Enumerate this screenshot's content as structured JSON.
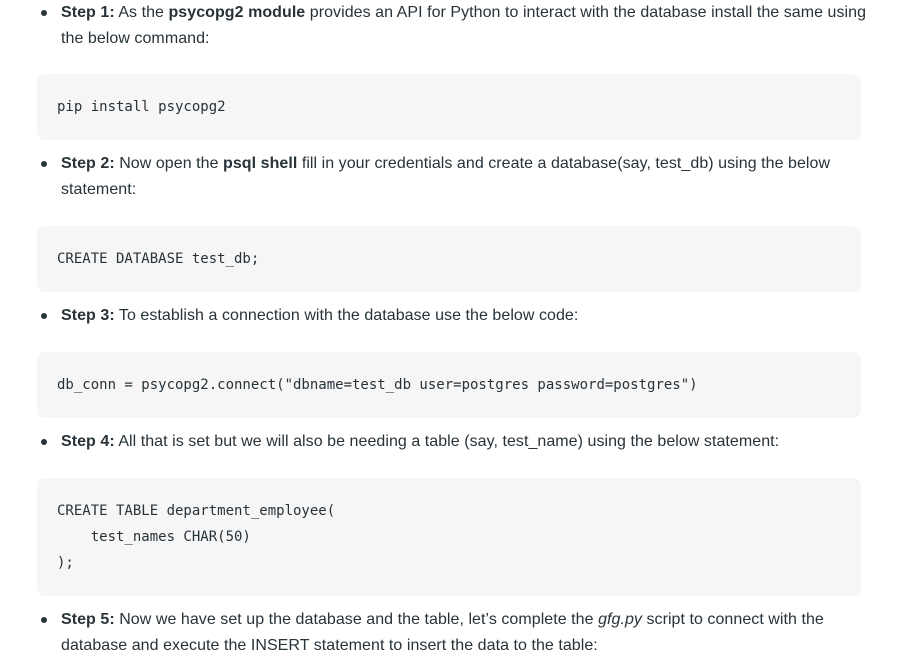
{
  "steps": [
    {
      "label": "Step 1:",
      "parts": [
        " As the ",
        "psycopg2 module",
        " provides an API for Python to interact with the database install the same using the below command:"
      ]
    },
    {
      "label": "Step 2:",
      "parts": [
        " Now open the ",
        "psql shell",
        " fill in your credentials and create a database(say, test_db) using the below statement:"
      ]
    },
    {
      "label": "Step 3:",
      "text": " To establish a connection with the database use the below code:"
    },
    {
      "label": "Step 4:",
      "text": " All that is set but we will also be needing a table (say, test_name) using the below statement:"
    },
    {
      "label": "Step 5:",
      "parts": [
        " Now we have set up the database and the table, let’s complete the ",
        "gfg.py",
        " script to connect with the database and execute the INSERT statement to insert the data to the table:"
      ]
    }
  ],
  "code_blocks": [
    {
      "lines": [
        "pip install psycopg2"
      ]
    },
    {
      "lines": [
        "CREATE DATABASE test_db;"
      ]
    },
    {
      "lines": [
        "db_conn = psycopg2.connect(\"dbname=test_db user=postgres password=postgres\")"
      ]
    },
    {
      "lines": [
        "CREATE TABLE department_employee(",
        "    test_names CHAR(50)",
        ");"
      ]
    }
  ]
}
